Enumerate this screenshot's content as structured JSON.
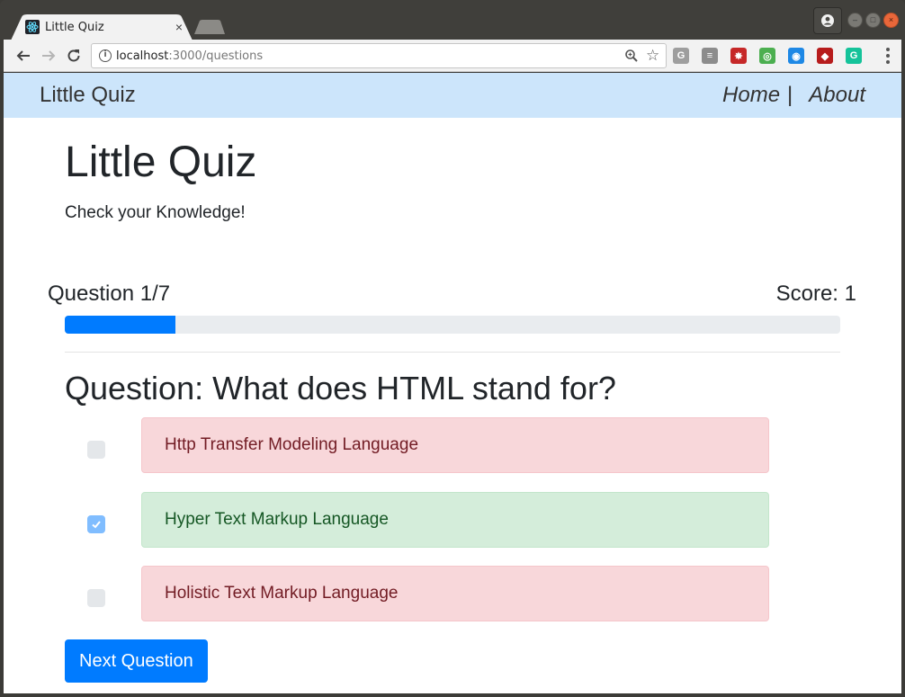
{
  "browser": {
    "tab_title": "Little Quiz",
    "tab_close": "×",
    "url_host": "localhost",
    "url_path": ":3000/questions",
    "info_glyph": "i",
    "extensions": [
      {
        "name": "g-extension-icon",
        "glyph": "G",
        "color": "#9e9e9e"
      },
      {
        "name": "reader-extension-icon",
        "glyph": "≡",
        "color": "#8c8c8c"
      },
      {
        "name": "red-extension-icon",
        "glyph": "✸",
        "color": "#c62828"
      },
      {
        "name": "green-circle-extension-icon",
        "glyph": "◎",
        "color": "#4caf50"
      },
      {
        "name": "chrome-extension-icon",
        "glyph": "◉",
        "color": "#1e88e5"
      },
      {
        "name": "diamond-extension-icon",
        "glyph": "◆",
        "color": "#b71c1c"
      },
      {
        "name": "grammarly-extension-icon",
        "glyph": "G",
        "color": "#15c39a"
      }
    ]
  },
  "navbar": {
    "brand": "Little Quiz",
    "links": [
      "Home",
      "About"
    ],
    "separator": "|"
  },
  "header": {
    "title": "Little Quiz",
    "subtitle": "Check your Knowledge!"
  },
  "quiz": {
    "question_counter": "Question 1/7",
    "score": "Score: 1",
    "progress_fraction": 0.143,
    "question": "Question: What does HTML stand for?",
    "answers": [
      {
        "text": "Http Transfer Modeling Language",
        "checked": false,
        "status": "wrong"
      },
      {
        "text": "Hyper Text Markup Language",
        "checked": true,
        "status": "right"
      },
      {
        "text": "Holistic Text Markup Language",
        "checked": false,
        "status": "wrong"
      }
    ],
    "next_label": "Next Question"
  },
  "colors": {
    "navbar_bg": "#cce5fb",
    "primary": "#007bff",
    "wrong_bg": "#f8d7da",
    "right_bg": "#d4edda"
  }
}
